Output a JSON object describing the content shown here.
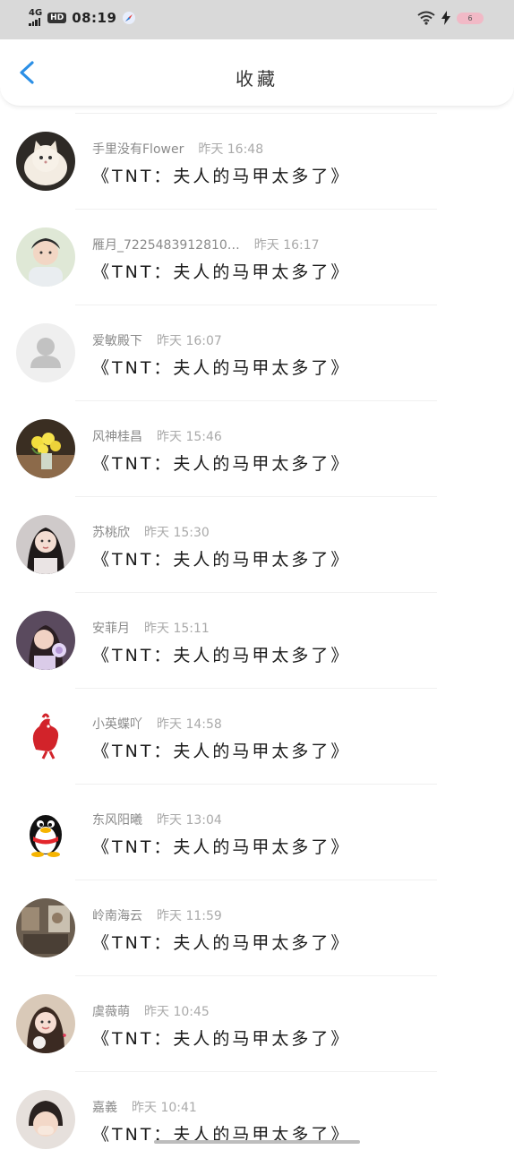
{
  "status_bar": {
    "network": "4G",
    "hd": "HD",
    "time": "08:19",
    "battery": "6"
  },
  "header": {
    "title": "收藏"
  },
  "favorites": [
    {
      "user": "手里没有Flower",
      "time": "昨天 16:48",
      "title": "《TNT：夫人的马甲太多了》",
      "avatar": "cat"
    },
    {
      "user": "雁月_7225483912810…",
      "time": "昨天 16:17",
      "title": "《TNT：夫人的马甲太多了》",
      "avatar": "boy-portrait"
    },
    {
      "user": "爱敏殿下",
      "time": "昨天 16:07",
      "title": "《TNT：夫人的马甲太多了》",
      "avatar": "default-user"
    },
    {
      "user": "风神桂昌",
      "time": "昨天 15:46",
      "title": "《TNT：夫人的马甲太多了》",
      "avatar": "flowers"
    },
    {
      "user": "苏桃欣",
      "time": "昨天 15:30",
      "title": "《TNT：夫人的马甲太多了》",
      "avatar": "woman-portrait"
    },
    {
      "user": "安菲月",
      "time": "昨天 15:11",
      "title": "《TNT：夫人的马甲太多了》",
      "avatar": "girl-portrait"
    },
    {
      "user": "小英蝶吖",
      "time": "昨天 14:58",
      "title": "《TNT：夫人的马甲太多了》",
      "avatar": "red-rooster"
    },
    {
      "user": "东风阳曦",
      "time": "昨天 13:04",
      "title": "《TNT：夫人的马甲太多了》",
      "avatar": "qq-penguin"
    },
    {
      "user": "岭南海云",
      "time": "昨天 11:59",
      "title": "《TNT：夫人的马甲太多了》",
      "avatar": "room-photo"
    },
    {
      "user": "虞薇萌",
      "time": "昨天 10:45",
      "title": "《TNT：夫人的马甲太多了》",
      "avatar": "girl-selfie"
    },
    {
      "user": "嘉義",
      "time": "昨天 10:41",
      "title": "《TNT：夫人的马甲太多了》",
      "avatar": "kid-photo"
    }
  ],
  "colors": {
    "accent": "#2b8fe6",
    "status_bar_bg": "#d9d9d9"
  }
}
